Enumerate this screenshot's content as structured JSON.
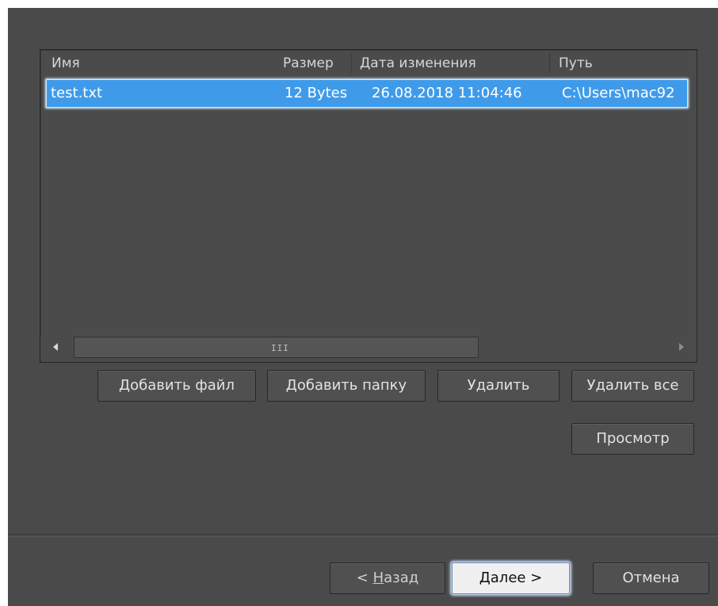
{
  "file_list": {
    "columns": [
      "Имя",
      "Размер",
      "Дата изменения",
      "Путь"
    ],
    "rows": [
      {
        "name": "test.txt",
        "size": "12 Bytes",
        "modified": "26.08.2018 11:04:46",
        "path": "C:\\Users\\mac92",
        "selected": true
      }
    ],
    "scrollbar_grip": "III"
  },
  "actions": {
    "add_file": "Добавить файл",
    "add_folder": "Добавить папку",
    "delete": "Удалить",
    "delete_all": "Удалить все",
    "preview": "Просмотр"
  },
  "wizard": {
    "back_prefix": "< ",
    "back_mnemonic": "Н",
    "back_rest": "азад",
    "next": "Далее >",
    "cancel": "Отмена"
  },
  "colors": {
    "background": "#4a4a4a",
    "selection": "#3f9bea"
  }
}
